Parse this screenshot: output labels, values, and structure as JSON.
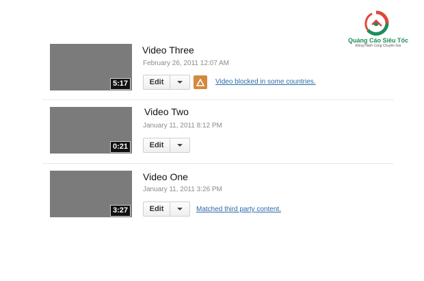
{
  "brand": {
    "name": "Quảng Cáo Siêu Tốc",
    "tagline": "Đồng Hành Cùng Chuyên Gia",
    "colors": {
      "green": "#1e8d5b",
      "red": "#e0453a"
    }
  },
  "videos": [
    {
      "title": "Video Three",
      "date": "February 26, 2011 12:07 AM",
      "duration": "5:17",
      "edit_label": "Edit",
      "notice": "Video blocked in some countries.",
      "warning_icon": "warning-triangle"
    },
    {
      "title": "Video Two",
      "date": "January 11, 2011 8:12 PM",
      "duration": "0:21",
      "edit_label": "Edit"
    },
    {
      "title": "Video One",
      "date": "January 11, 2011 3:26 PM",
      "duration": "3:27",
      "edit_label": "Edit",
      "notice": "Matched third party content."
    }
  ]
}
